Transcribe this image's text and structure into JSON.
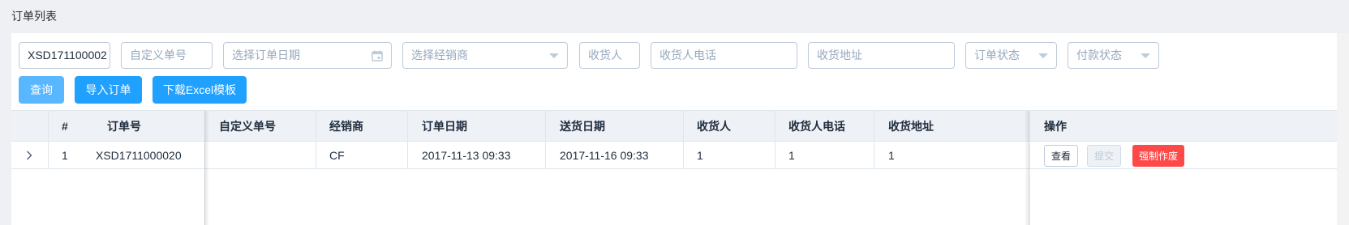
{
  "page": {
    "title": "订单列表"
  },
  "filters": {
    "order_no_value": "XSD171100002",
    "custom_no_placeholder": "自定义单号",
    "order_date_placeholder": "选择订单日期",
    "dealer_placeholder": "选择经销商",
    "receiver_placeholder": "收货人",
    "receiver_phone_placeholder": "收货人电话",
    "receiver_address_placeholder": "收货地址",
    "order_status_placeholder": "订单状态",
    "payment_status_placeholder": "付款状态"
  },
  "actions": {
    "query": "查询",
    "import": "导入订单",
    "download": "下载Excel模板"
  },
  "table": {
    "columns": {
      "index": "#",
      "order_no": "订单号",
      "custom_no": "自定义单号",
      "dealer": "经销商",
      "order_date": "订单日期",
      "delivery_date": "送货日期",
      "receiver": "收货人",
      "receiver_phone": "收货人电话",
      "receiver_address": "收货地址",
      "operations": "操作"
    },
    "rows": [
      {
        "index": "1",
        "order_no": "XSD1711000020",
        "custom_no": "",
        "dealer": "CF",
        "order_date": "2017-11-13 09:33",
        "delivery_date": "2017-11-16 09:33",
        "receiver": "1",
        "receiver_phone": "1",
        "receiver_address": "1",
        "ops": {
          "view": "查看",
          "submit": "提交",
          "force_void": "强制作废"
        }
      }
    ]
  },
  "colors": {
    "primary": "#20a0ff",
    "primary_light": "#58b7ff",
    "danger": "#ff4949",
    "border": "#dfe6ec",
    "header_bg": "#eef1f6"
  }
}
